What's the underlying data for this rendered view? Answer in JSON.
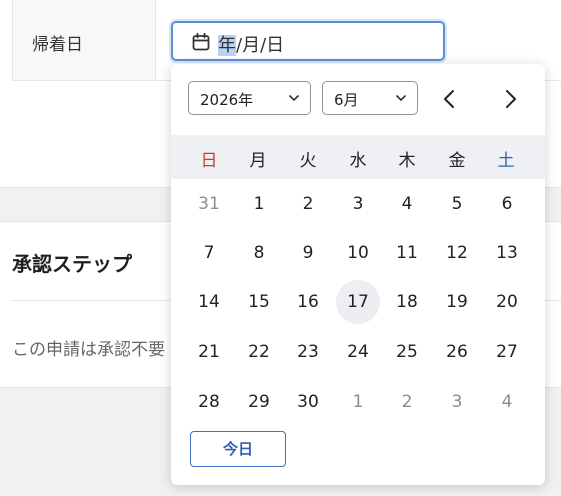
{
  "form": {
    "label": "帰着日",
    "date_input": {
      "year": "年",
      "sep1": "/",
      "month": "月",
      "sep2": "/",
      "day": "日"
    }
  },
  "section": {
    "title": "承認ステップ",
    "note": "この申請は承認不要"
  },
  "picker": {
    "year_select": "2026年",
    "month_select": "6月",
    "weekdays": [
      "日",
      "月",
      "火",
      "水",
      "木",
      "金",
      "土"
    ],
    "weeks": [
      [
        "31",
        "1",
        "2",
        "3",
        "4",
        "5",
        "6"
      ],
      [
        "7",
        "8",
        "9",
        "10",
        "11",
        "12",
        "13"
      ],
      [
        "14",
        "15",
        "16",
        "17",
        "18",
        "19",
        "20"
      ],
      [
        "21",
        "22",
        "23",
        "24",
        "25",
        "26",
        "27"
      ],
      [
        "28",
        "29",
        "30",
        "1",
        "2",
        "3",
        "4"
      ]
    ],
    "today_label": "今日"
  },
  "colors": {
    "sunday": "#d23b2f",
    "saturday": "#2f5fb3",
    "accent": "#5d8fd8",
    "today_bg": "#eceef1"
  }
}
